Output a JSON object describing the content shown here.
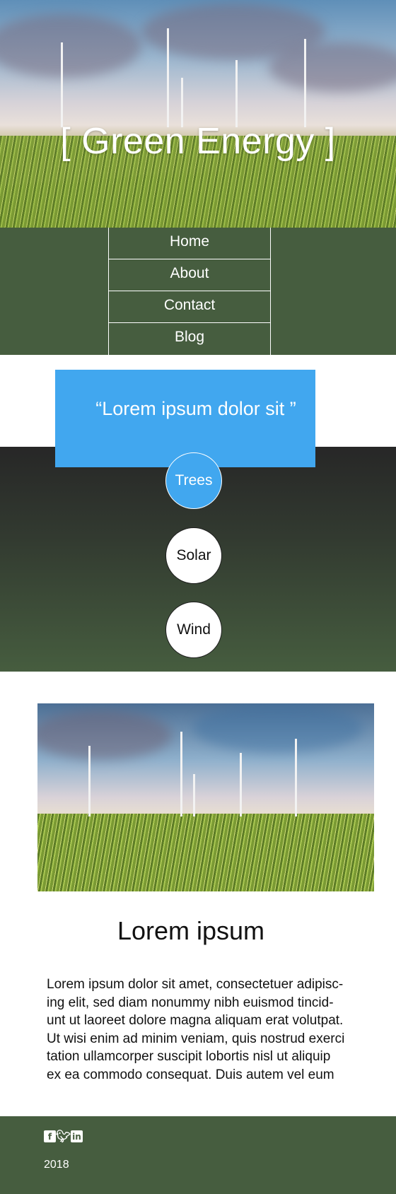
{
  "hero": {
    "title": "[ Green Energy ]"
  },
  "nav": {
    "items": [
      "Home",
      "About",
      "Contact",
      "Blog"
    ]
  },
  "quote": {
    "text": "“Lorem ipsum dolor sit ”"
  },
  "topics": {
    "items": [
      "Trees",
      "Solar",
      "Wind"
    ],
    "active": "Trees"
  },
  "article": {
    "title": "Lorem ipsum",
    "body_lines": [
      "Lorem ipsum dolor sit amet, consectetuer adipisc-",
      "ing elit, sed diam nonummy nibh euismod tincid-",
      "unt ut laoreet dolore magna aliquam erat volutpat.",
      "Ut wisi enim ad minim veniam, quis nostrud exerci",
      "tation ullamcorper suscipit lobortis nisl ut aliquip",
      "ex ea commodo consequat. Duis autem vel eum"
    ]
  },
  "footer": {
    "social_icons": [
      "facebook-icon",
      "twitter-icon",
      "linkedin-icon"
    ],
    "year": "2018"
  },
  "colors": {
    "nav_green": "#465d3f",
    "accent_blue": "#41a7ef",
    "dark": "#272727"
  }
}
